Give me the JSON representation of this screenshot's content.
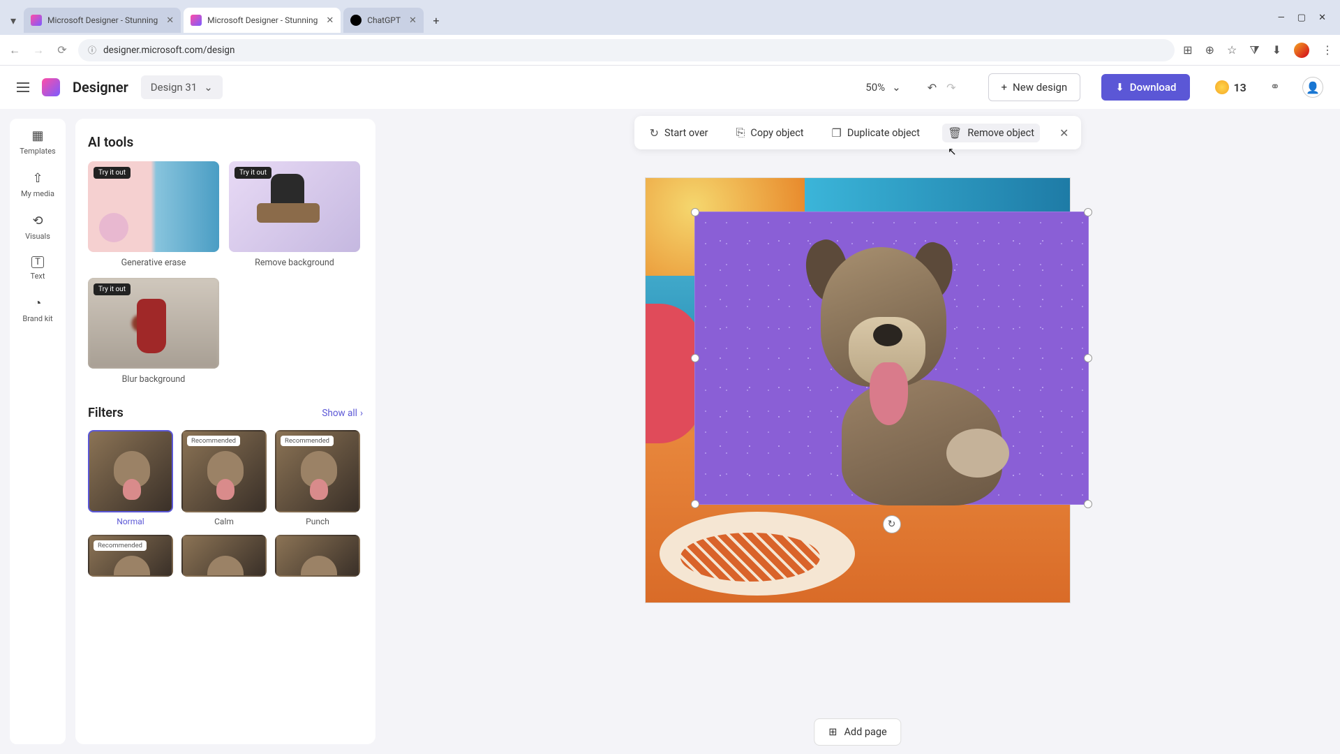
{
  "browser": {
    "tabs": [
      {
        "title": "Microsoft Designer - Stunning",
        "favicon": "linear-gradient(135deg,#ff4da6,#7b5cff)"
      },
      {
        "title": "Microsoft Designer - Stunning",
        "favicon": "linear-gradient(135deg,#ff4da6,#7b5cff)"
      },
      {
        "title": "ChatGPT",
        "favicon": "#000"
      }
    ],
    "url": "designer.microsoft.com/design"
  },
  "app": {
    "brand": "Designer",
    "doc_name": "Design 31",
    "zoom": "50%",
    "new_design_label": "New design",
    "download_label": "Download",
    "coins": "13"
  },
  "rail": {
    "items": [
      {
        "label": "Templates",
        "icon": "▦"
      },
      {
        "label": "My media",
        "icon": "⇧"
      },
      {
        "label": "Visuals",
        "icon": "⟲"
      },
      {
        "label": "Text",
        "icon": "T"
      },
      {
        "label": "Brand kit",
        "icon": "⚙"
      }
    ]
  },
  "panel": {
    "ai_tools_heading": "AI tools",
    "try_tag": "Try it out",
    "tools": [
      {
        "label": "Generative erase"
      },
      {
        "label": "Remove background"
      },
      {
        "label": "Blur background"
      }
    ],
    "filters_heading": "Filters",
    "show_all": "Show all",
    "recommended_tag": "Recommended",
    "filters": [
      {
        "label": "Normal",
        "selected": true,
        "recommended": false
      },
      {
        "label": "Calm",
        "selected": false,
        "recommended": true
      },
      {
        "label": "Punch",
        "selected": false,
        "recommended": true
      },
      {
        "label": "",
        "selected": false,
        "recommended": true
      },
      {
        "label": "",
        "selected": false,
        "recommended": false
      },
      {
        "label": "",
        "selected": false,
        "recommended": false
      }
    ]
  },
  "context_bar": {
    "start_over": "Start over",
    "copy": "Copy object",
    "duplicate": "Duplicate object",
    "remove": "Remove object"
  },
  "footer": {
    "add_page": "Add page"
  },
  "colors": {
    "accent": "#5b57d6"
  }
}
